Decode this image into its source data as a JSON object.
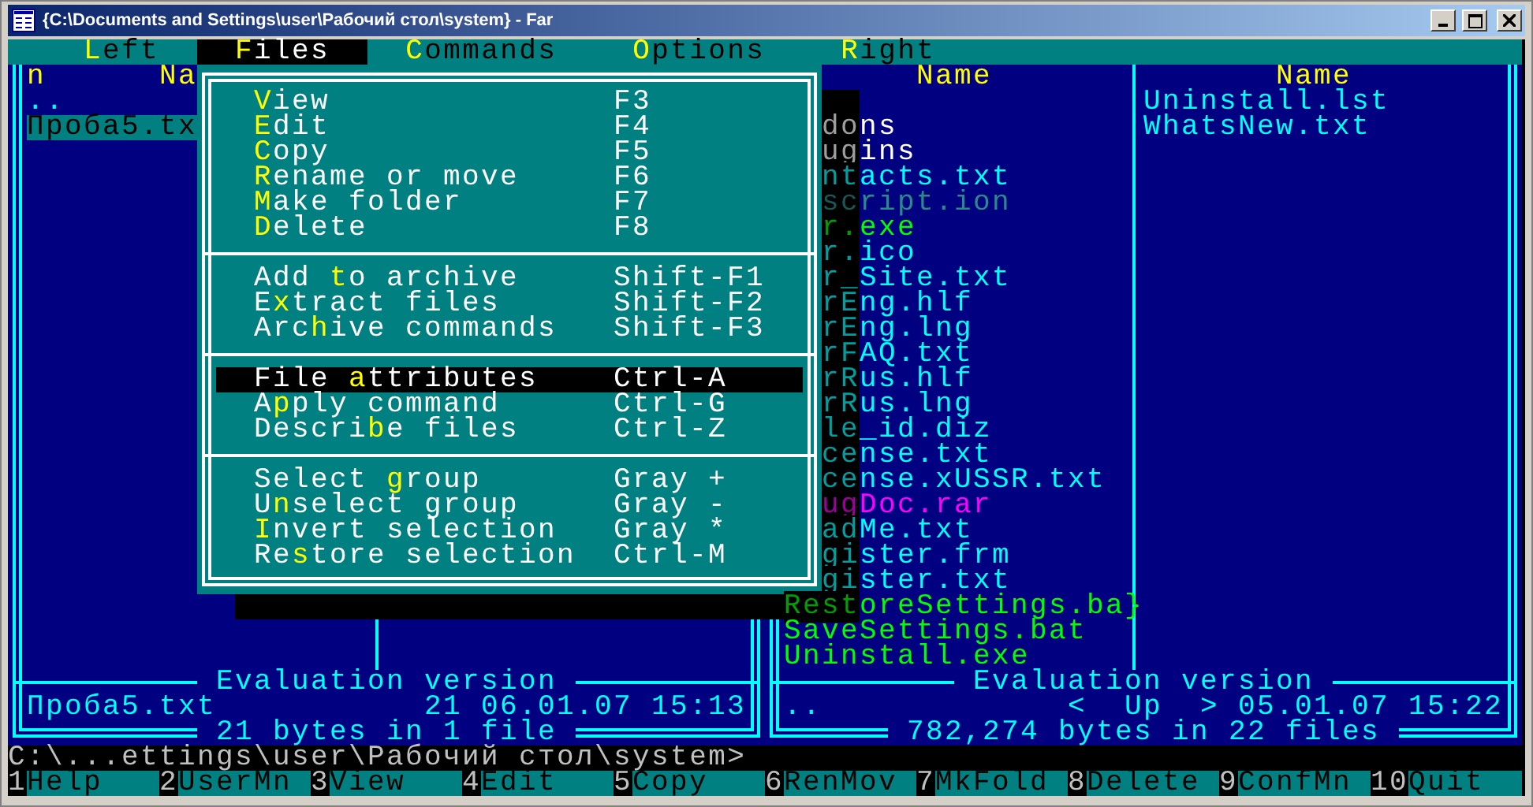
{
  "window": {
    "title": "{C:\\Documents and Settings\\user\\Рабочий стол\\system} - Far"
  },
  "menu_bar": [
    {
      "label": "**L**eft",
      "selected": false
    },
    {
      "label": "**F**iles",
      "selected": true
    },
    {
      "label": "**C**ommands",
      "selected": false
    },
    {
      "label": "**O**ptions",
      "selected": false
    },
    {
      "label": "**R**ight",
      "selected": false
    }
  ],
  "left_panel": {
    "columns": [
      {
        "header": "n",
        "files": [
          {
            "name": "..",
            "color": "#00ffff",
            "selected": false
          },
          {
            "name": "Проба5.tx",
            "selected": true
          }
        ]
      },
      {
        "header": "Na"
      }
    ],
    "title": "Evaluation version",
    "info_name": "Проба5.txt",
    "info_details": "21 06.01.07 15:13",
    "summary": "21 bytes in 1 file"
  },
  "right_panel": {
    "columns": [
      {
        "header": "Name",
        "files": [
          {
            "name": "dons",
            "color": "#ffffff",
            "selected": false
          },
          {
            "name": "ugins",
            "color": "#ffffff",
            "selected": false
          },
          {
            "name": "ntacts.txt",
            "color": "#00ffff",
            "selected": false
          },
          {
            "name": "script.ion",
            "color": "#2a8a8a",
            "selected": false
          },
          {
            "name": "r.exe",
            "color": "#00ff00",
            "selected": false
          },
          {
            "name": "r.ico",
            "color": "#00ffff",
            "selected": false
          },
          {
            "name": "r_Site.txt",
            "color": "#00ffff",
            "selected": false
          },
          {
            "name": "rEng.hlf",
            "color": "#00ffff",
            "selected": false
          },
          {
            "name": "rEng.lng",
            "color": "#00ffff",
            "selected": false
          },
          {
            "name": "rFAQ.txt",
            "color": "#00ffff",
            "selected": false
          },
          {
            "name": "rRus.hlf",
            "color": "#00ffff",
            "selected": false
          },
          {
            "name": "rRus.lng",
            "color": "#00ffff",
            "selected": false
          },
          {
            "name": "le_id.diz",
            "color": "#00ffff",
            "selected": false
          },
          {
            "name": "cense.txt",
            "color": "#00ffff",
            "selected": false
          },
          {
            "name": "cense.xUSSR.txt",
            "color": "#00ffff",
            "selected": false
          },
          {
            "name": "ugDoc.rar",
            "color": "#ff00ff",
            "selected": false
          },
          {
            "name": "adMe.txt",
            "color": "#00ffff",
            "selected": false
          },
          {
            "name": "gister.frm",
            "color": "#00ffff",
            "selected": false
          },
          {
            "name": "gister.txt",
            "color": "#00ffff",
            "selected": false
          },
          {
            "name": "RestoreSettings.ba}",
            "color": "#00ff00",
            "selected": false
          },
          {
            "name": "SaveSettings.bat",
            "color": "#00ff00",
            "selected": false
          },
          {
            "name": "Uninstall.exe",
            "color": "#00ff00",
            "selected": false
          }
        ]
      },
      {
        "header": "Name",
        "files": [
          {
            "name": "Uninstall.lst",
            "color": "#00ffff",
            "selected": false
          },
          {
            "name": "WhatsNew.txt",
            "color": "#00ffff",
            "selected": false
          }
        ]
      }
    ],
    "title": "Evaluation version",
    "info_name": "..",
    "info_details": "<  Up  > 05.01.07 15:22",
    "summary": "782,274 bytes in 22 files"
  },
  "files_menu": [
    {
      "kind": "item",
      "label": "**V**iew",
      "shortcut": "F3",
      "selected": false
    },
    {
      "kind": "item",
      "label": "**E**dit",
      "shortcut": "F4",
      "selected": false
    },
    {
      "kind": "item",
      "label": "**C**opy",
      "shortcut": "F5",
      "selected": false
    },
    {
      "kind": "item",
      "label": "**R**ename or move",
      "shortcut": "F6",
      "selected": false
    },
    {
      "kind": "item",
      "label": "**M**ake folder",
      "shortcut": "F7",
      "selected": false
    },
    {
      "kind": "item",
      "label": "**D**elete",
      "shortcut": "F8",
      "selected": false
    },
    {
      "kind": "separator"
    },
    {
      "kind": "item",
      "label": "Add **t**o archive",
      "shortcut": "Shift-F1",
      "selected": false
    },
    {
      "kind": "item",
      "label": "E**x**tract files",
      "shortcut": "Shift-F2",
      "selected": false
    },
    {
      "kind": "item",
      "label": "Arc**h**ive commands",
      "shortcut": "Shift-F3",
      "selected": false
    },
    {
      "kind": "separator"
    },
    {
      "kind": "item",
      "label": "File **a**ttributes",
      "shortcut": "Ctrl-A",
      "selected": true
    },
    {
      "kind": "item",
      "label": "A**p**ply command",
      "shortcut": "Ctrl-G",
      "selected": false
    },
    {
      "kind": "item",
      "label": "Descri**b**e files",
      "shortcut": "Ctrl-Z",
      "selected": false
    },
    {
      "kind": "separator"
    },
    {
      "kind": "item",
      "label": "Select **g**roup",
      "shortcut": "Gray +",
      "selected": false
    },
    {
      "kind": "item",
      "label": "U**n**select group",
      "shortcut": "Gray -",
      "selected": false
    },
    {
      "kind": "item",
      "label": "**I**nvert selection",
      "shortcut": "Gray *",
      "selected": false
    },
    {
      "kind": "item",
      "label": "Re**s**tore selection",
      "shortcut": "Ctrl-M",
      "selected": false
    }
  ],
  "command_line": "C:\\...ettings\\user\\Рабочий стол\\system>",
  "key_bar": [
    {
      "key": "1",
      "label": "Help"
    },
    {
      "key": "2",
      "label": "UserMn"
    },
    {
      "key": "3",
      "label": "View"
    },
    {
      "key": "4",
      "label": "Edit"
    },
    {
      "key": "5",
      "label": "Copy"
    },
    {
      "key": "6",
      "label": "RenMov"
    },
    {
      "key": "7",
      "label": "MkFold"
    },
    {
      "key": "8",
      "label": "Delete"
    },
    {
      "key": "9",
      "label": "ConfMn"
    },
    {
      "key": "10",
      "label": "Quit"
    }
  ]
}
